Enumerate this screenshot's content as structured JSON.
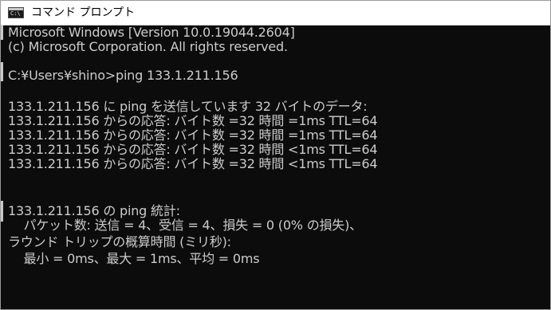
{
  "window": {
    "title": "コマンド プロンプト",
    "icon": "cmd-icon",
    "icon_glyph": "C:\\",
    "background": "#0c0c0c",
    "foreground": "#cccccc"
  },
  "console": {
    "lines": [
      "Microsoft Windows [Version 10.0.19044.2604]",
      "(c) Microsoft Corporation. All rights reserved.",
      "",
      "C:¥Users¥shino>ping 133.1.211.156",
      "",
      "133.1.211.156 に ping を送信しています 32 バイトのデータ:",
      "133.1.211.156 からの応答: バイト数 =32 時間 =1ms TTL=64",
      "133.1.211.156 からの応答: バイト数 =32 時間 =1ms TTL=64",
      "133.1.211.156 からの応答: バイト数 =32 時間 <1ms TTL=64",
      "133.1.211.156 からの応答: バイト数 =32 時間 <1ms TTL=64",
      "",
      "133.1.211.156 の ping 統計:",
      "    パケット数: 送信 = 4、受信 = 4、損失 = 0 (0% の損失)、",
      "ラウンド トリップの概算時間 (ミリ秒):",
      "    最小 = 0ms、最大 = 1ms、平均 = 0ms"
    ]
  }
}
